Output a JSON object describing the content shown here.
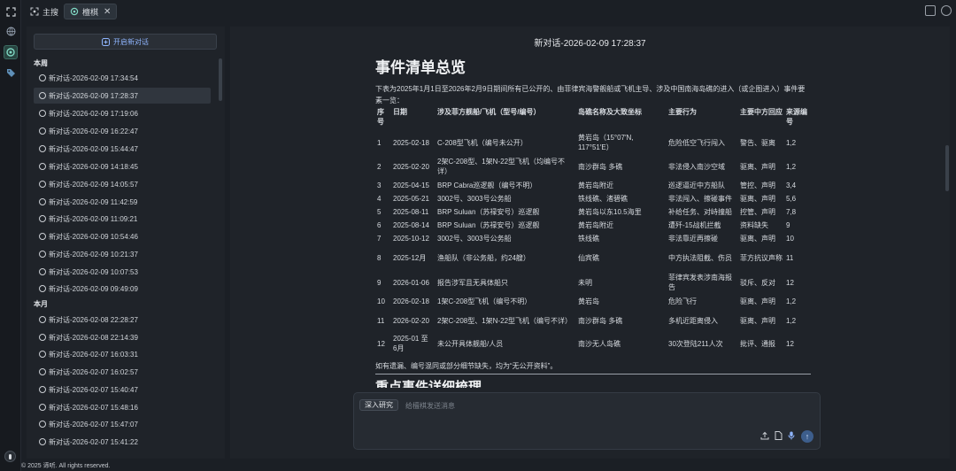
{
  "tabs": [
    {
      "label": "主搜"
    },
    {
      "label": "檀棋"
    }
  ],
  "sidebar": {
    "new_chat": "开启新对话",
    "groups": [
      {
        "title": "本周",
        "items": [
          "新对话-2026-02-09 17:34:54",
          "新对话-2026-02-09 17:28:37",
          "新对话-2026-02-09 17:19:06",
          "新对话-2026-02-09 16:22:47",
          "新对话-2026-02-09 15:44:47",
          "新对话-2026-02-09 14:18:45",
          "新对话-2026-02-09 14:05:57",
          "新对话-2026-02-09 11:42:59",
          "新对话-2026-02-09 11:09:21",
          "新对话-2026-02-09 10:54:46",
          "新对话-2026-02-09 10:21:37",
          "新对话-2026-02-09 10:07:53",
          "新对话-2026-02-09 09:49:09"
        ]
      },
      {
        "title": "本月",
        "items": [
          "新对话-2026-02-08 22:28:27",
          "新对话-2026-02-08 22:14:39",
          "新对话-2026-02-07 16:03:31",
          "新对话-2026-02-07 16:02:57",
          "新对话-2026-02-07 15:40:47",
          "新对话-2026-02-07 15:48:16",
          "新对话-2026-02-07 15:47:07",
          "新对话-2026-02-07 15:41:22"
        ]
      }
    ]
  },
  "main": {
    "conversation_title": "新对话-2026-02-09 17:28:37",
    "heading": "事件清单总览",
    "intro": "下表为2025年1月1日至2026年2月9日期间所有已公开的、由菲律宾海警舰船或飞机主导、涉及中国南海岛礁的进入（或企图进入）事件要素一览：",
    "table_headers": [
      "序号",
      "日期",
      "涉及菲方舰船/飞机（型号/编号）",
      "岛礁名称及大致坐标",
      "主要行为",
      "主要中方回应",
      "来源编号"
    ],
    "table_rows": [
      [
        "1",
        "2025-02-18",
        "C-208型飞机（编号未公开）",
        "黄岩岛（15°07′N, 117°51′E）",
        "危险低空飞行闯入",
        "警告、驱离",
        "1,2"
      ],
      [
        "2",
        "2025-02-20",
        "2架C-208型、1架N-22型飞机（均编号不详）",
        "南沙群岛 多礁",
        "非法侵入南沙空域",
        "驱离、声明",
        "1,2"
      ],
      [
        "3",
        "2025-04-15",
        "BRP Cabra巡逻舰（编号不明）",
        "黄岩岛附近",
        "巡逻逼近中方船队",
        "管控、声明",
        "3,4"
      ],
      [
        "4",
        "2025-05-21",
        "3002号、3003号公务船",
        "铁线礁、渚碧礁",
        "非法闯入、擦碰事件",
        "驱离、声明",
        "5,6"
      ],
      [
        "5",
        "2025-08-11",
        "BRP Suluan（苏禄安号）巡逻舰",
        "黄岩岛以东10.5海里",
        "补给任务、对峙撞船",
        "控管、声明",
        "7,8"
      ],
      [
        "6",
        "2025-08-14",
        "BRP Suluan（苏禄安号）巡逻舰",
        "黄岩岛附近",
        "遭歼-15战机拦截",
        "资料缺失",
        "9"
      ],
      [
        "7",
        "2025-10-12",
        "3002号、3003号公务船",
        "铁线礁",
        "非法靠近再擦碰",
        "驱离、声明",
        "10"
      ],
      [
        "8",
        "2025-12月",
        "渔船队（非公务船，约24艘）",
        "仙宾礁",
        "中方执法阻截、伤员",
        "菲方抗议声称",
        "11"
      ],
      [
        "9",
        "2026-01-06",
        "报告涉军且无具体船只",
        "未明",
        "菲律宾发表涉南海报告",
        "驳斥、反对",
        "12"
      ],
      [
        "10",
        "2026-02-18",
        "1架C-208型飞机（编号不明）",
        "黄岩岛",
        "危险飞行",
        "驱离、声明",
        "1,2"
      ],
      [
        "11",
        "2026-02-20",
        "2架C-208型、1架N-22型飞机（编号不详）",
        "南沙群岛 多礁",
        "多机近距离侵入",
        "驱离、声明",
        "1,2"
      ],
      [
        "12",
        "2025-01 至 6月",
        "未公开具体舰船/人员",
        "南沙无人岛礁",
        "30次登陆211人次",
        "批评、通报",
        "12"
      ]
    ],
    "footnote": "如有遗漏、编号混同或部分细节缺失，均为“无公开资料”。",
    "section2_heading": "重点事件详细梳理"
  },
  "composer": {
    "deep_research": "深入研究",
    "placeholder": "给檀棋发送消息"
  },
  "footer": "© 2025 谛听. All rights reserved."
}
